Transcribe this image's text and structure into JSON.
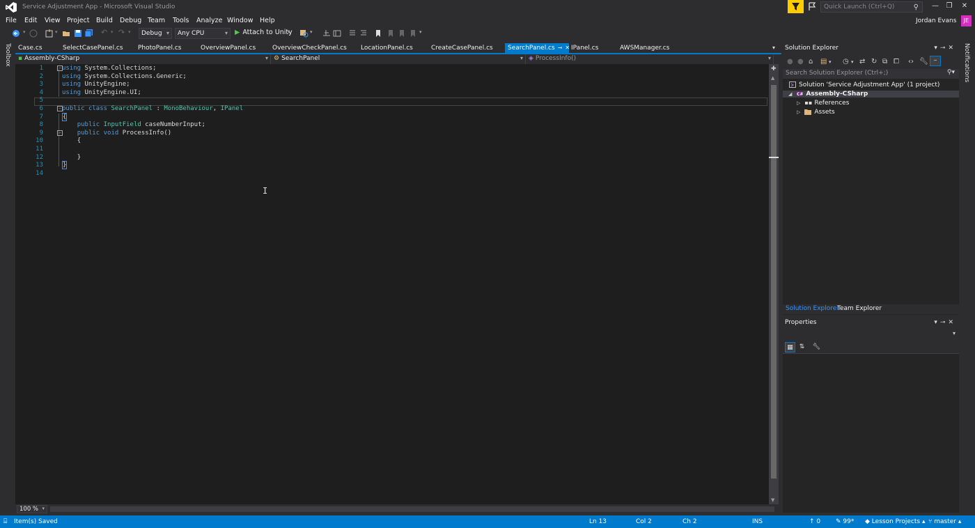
{
  "window": {
    "title": "Service Adjustment App - Microsoft Visual Studio",
    "quick_launch_placeholder": "Quick Launch (Ctrl+Q)",
    "user_name": "Jordan Evans",
    "user_initials": "JE"
  },
  "menu": [
    "File",
    "Edit",
    "View",
    "Project",
    "Build",
    "Debug",
    "Team",
    "Tools",
    "Analyze",
    "Window",
    "Help"
  ],
  "toolbar": {
    "configuration": "Debug",
    "platform": "Any CPU",
    "attach_label": "Attach to Unity"
  },
  "side_labels": {
    "toolbox": "Toolbox",
    "notifications": "Notifications"
  },
  "tabs": [
    {
      "label": "Case.cs"
    },
    {
      "label": "SelectCasePanel.cs"
    },
    {
      "label": "PhotoPanel.cs"
    },
    {
      "label": "OverviewPanel.cs"
    },
    {
      "label": "OverviewCheckPanel.cs"
    },
    {
      "label": "LocationPanel.cs"
    },
    {
      "label": "CreateCasePanel.cs"
    },
    {
      "label": "SearchPanel.cs",
      "active": true
    },
    {
      "label": "IPanel.cs"
    },
    {
      "label": "AWSManager.cs"
    }
  ],
  "navbar": {
    "project": "Assembly-CSharp",
    "type": "SearchPanel",
    "member": "ProcessInfo()"
  },
  "code": {
    "line_numbers": [
      "1",
      "2",
      "3",
      "4",
      "5",
      "6",
      "7",
      "8",
      "9",
      "10",
      "11",
      "12",
      "13",
      "14"
    ],
    "l1_kw": "using",
    "l1_rest": " System.Collections;",
    "l2_kw": "using",
    "l2_rest": " System.Collections.Generic;",
    "l3_kw": "using",
    "l3_rest": " UnityEngine;",
    "l4_kw": "using",
    "l4_rest": " UnityEngine.UI;",
    "l6_kw1": "public",
    "l6_kw2": "class",
    "l6_name": "SearchPanel",
    "l6_colon": " : ",
    "l6_base": "MonoBehaviour",
    "l6_sep": ", ",
    "l6_iface": "IPanel",
    "l7": "{",
    "l8_kw": "public",
    "l8_type": "InputField",
    "l8_rest": " caseNumberInput;",
    "l9_kw1": "public",
    "l9_kw2": "void",
    "l9_rest": " ProcessInfo()",
    "l10": "{",
    "l12": "}",
    "l13": "}"
  },
  "zoom": "100 %",
  "solution_explorer": {
    "title": "Solution Explorer",
    "search_placeholder": "Search Solution Explorer (Ctrl+;)",
    "solution": "Solution 'Service Adjustment App' (1 project)",
    "project": "Assembly-CSharp",
    "references": "References",
    "assets": "Assets"
  },
  "panel_tabs": {
    "solution_explorer": "Solution Explorer",
    "team_explorer": "Team Explorer"
  },
  "properties": {
    "title": "Properties"
  },
  "status": {
    "message": "Item(s) Saved",
    "ln": "Ln 13",
    "col": "Col 2",
    "ch": "Ch 2",
    "ins": "INS",
    "push_count": "0",
    "pencil_count": "99*",
    "repo": "Lesson Projects",
    "branch": "master"
  },
  "colors": {
    "accent": "#007acc",
    "editor_bg": "#1e1e1e",
    "keyword": "#569cd6",
    "type": "#4ec9b0",
    "line_number": "#2b91af",
    "avatar": "#d42fbf",
    "filter": "#ffcc00"
  }
}
